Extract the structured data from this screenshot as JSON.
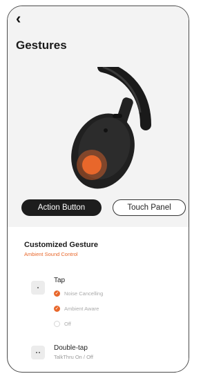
{
  "header": {
    "back_icon": "back-chevron-icon",
    "title": "Gestures"
  },
  "tabs": [
    {
      "label": "Action Button",
      "active": true
    },
    {
      "label": "Touch Panel",
      "active": false
    }
  ],
  "card": {
    "title": "Customized Gesture",
    "subtitle": "Ambient Sound Control",
    "gestures": [
      {
        "label": "Tap",
        "options": [
          {
            "label": "Noise Cancelling",
            "selected": true
          },
          {
            "label": "Ambient Aware",
            "selected": true
          },
          {
            "label": "Off",
            "selected": false
          }
        ]
      },
      {
        "label": "Double-tap",
        "sub": "TalkThru On / Off"
      }
    ]
  },
  "colors": {
    "accent": "#e8672b",
    "active_tab_bg": "#1d1d1d",
    "header_bg": "#f3f3f3"
  }
}
